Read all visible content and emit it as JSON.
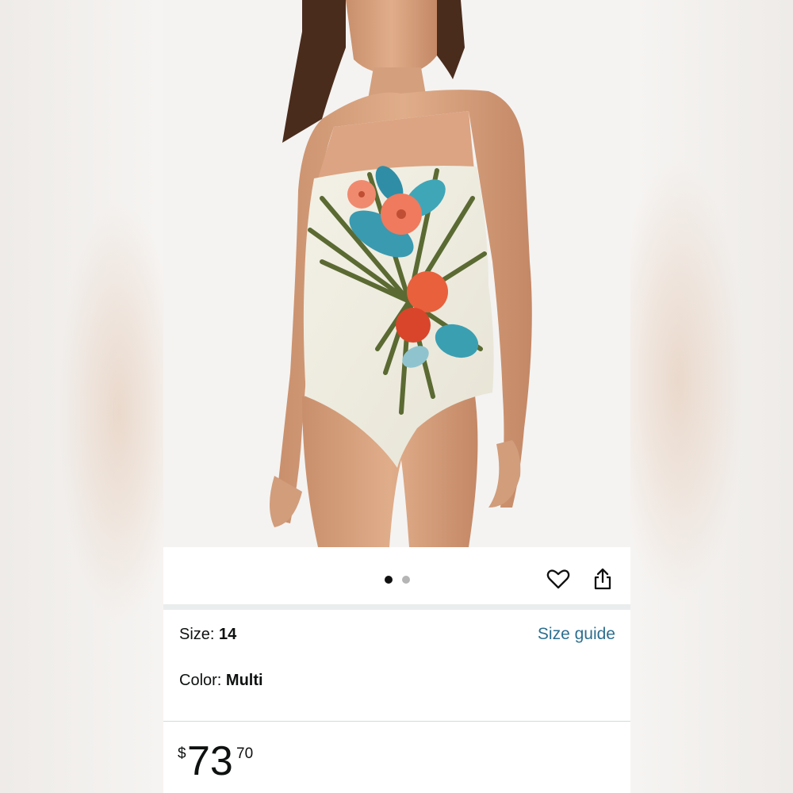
{
  "gallery": {
    "image_alt": "Strapless one-piece swimsuit with tropical palm and hibiscus print",
    "dot_count": 2,
    "active_dot": 1
  },
  "icons": {
    "favorite": "heart-icon",
    "share": "share-icon"
  },
  "size": {
    "label": "Size: ",
    "value": "14",
    "guide_link": "Size guide"
  },
  "color": {
    "label": "Color: ",
    "value": "Multi"
  },
  "price": {
    "symbol": "$",
    "whole": "73",
    "fraction": "70"
  },
  "colors": {
    "link": "#2d6f8f",
    "text": "#0f1111",
    "active_dot": "#111111",
    "inactive_dot": "#b5b5b5"
  }
}
